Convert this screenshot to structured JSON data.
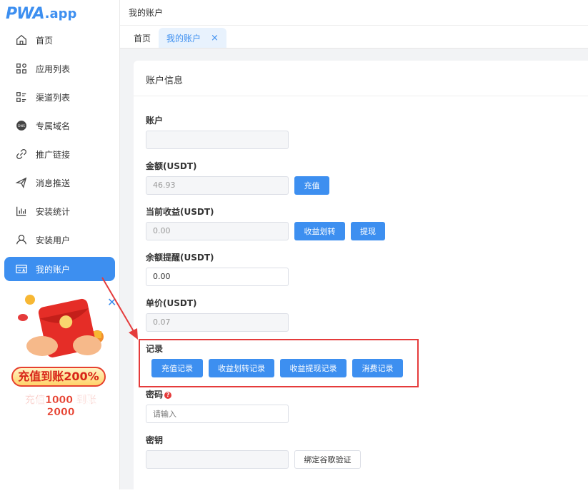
{
  "logo": {
    "brand": "PWA",
    "tld": ".app"
  },
  "sidebar": {
    "items": [
      {
        "label": "首页",
        "icon": "home-icon"
      },
      {
        "label": "应用列表",
        "icon": "apps-icon"
      },
      {
        "label": "渠道列表",
        "icon": "list-icon"
      },
      {
        "label": "专属域名",
        "icon": "dns-icon"
      },
      {
        "label": "推广链接",
        "icon": "link-icon"
      },
      {
        "label": "消息推送",
        "icon": "send-icon"
      },
      {
        "label": "安装统计",
        "icon": "chart-icon"
      },
      {
        "label": "安装用户",
        "icon": "user-icon"
      },
      {
        "label": "我的账户",
        "icon": "account-card-icon",
        "active": true
      }
    ]
  },
  "promo": {
    "line1": "充值到账200%",
    "line2": "充值1000 到账2000",
    "close": "✕"
  },
  "header": {
    "breadcrumb": "我的账户"
  },
  "tabs": [
    {
      "label": "首页"
    },
    {
      "label": "我的账户",
      "active": true,
      "close": "×"
    }
  ],
  "card": {
    "title": "账户信息",
    "account": {
      "label": "账户",
      "value": ""
    },
    "amount": {
      "label": "金额(USDT)",
      "value": "46.93",
      "recharge_button": "充值"
    },
    "earnings": {
      "label": "当前收益(USDT)",
      "value": "0.00",
      "transfer_button": "收益划转",
      "withdraw_button": "提现"
    },
    "balance_alert": {
      "label": "余额提醒(USDT)",
      "value": "0.00"
    },
    "unit_price": {
      "label": "单价(USDT)",
      "value": "0.07"
    },
    "records": {
      "label": "记录",
      "buttons": [
        "充值记录",
        "收益划转记录",
        "收益提现记录",
        "消费记录"
      ]
    },
    "password": {
      "label": "密码",
      "help": "?",
      "placeholder": "请输入"
    },
    "secret": {
      "label": "密钥",
      "value": "",
      "bind_button": "绑定谷歌验证"
    }
  },
  "colors": {
    "primary": "#3d8ff0",
    "highlight": "#e53b3b"
  }
}
